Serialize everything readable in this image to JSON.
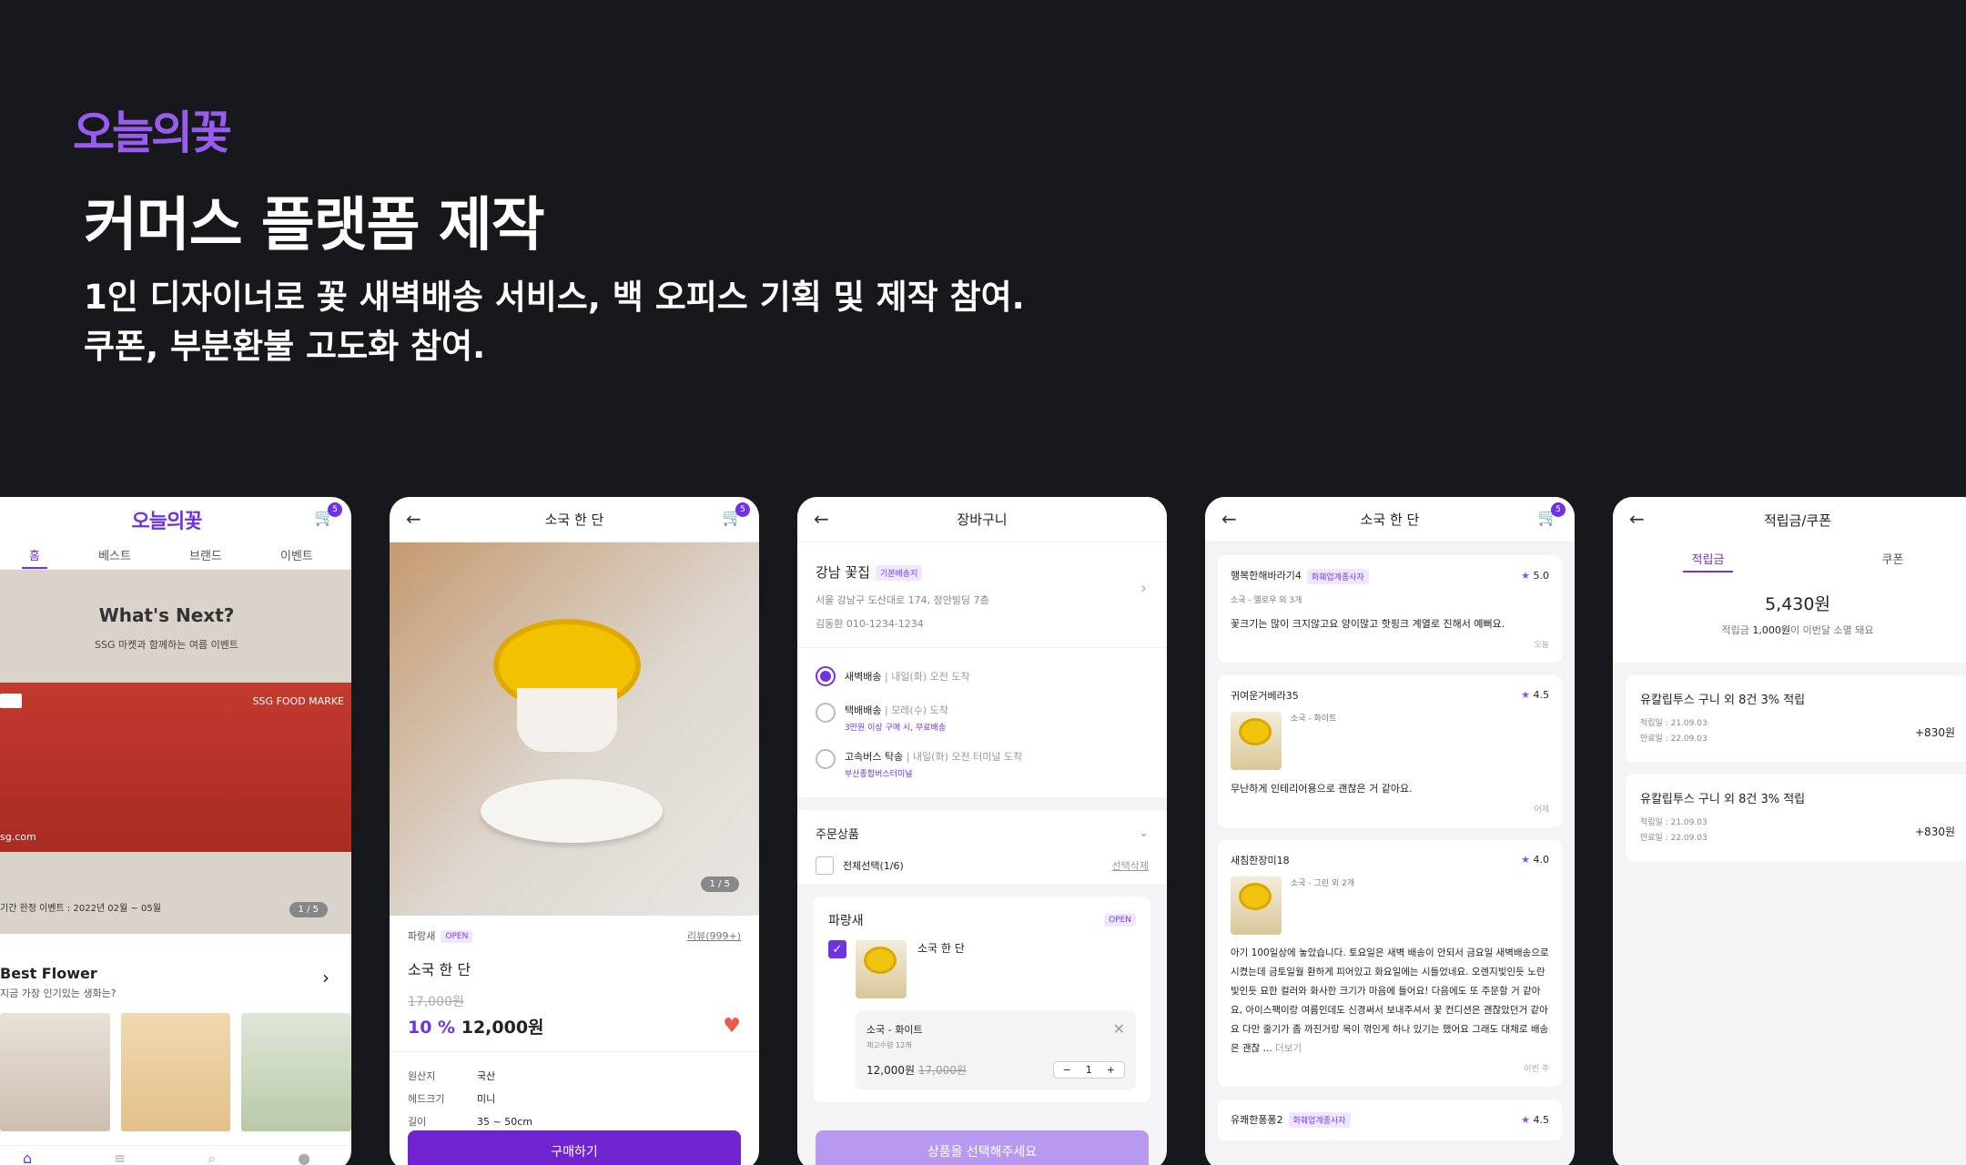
{
  "brand": {
    "logo": "오늘의꽃"
  },
  "hero": {
    "title": "커머스 플랫폼 제작",
    "line1": "1인 디자이너로 꽃 새벽배송 서비스, 백 오피스 기획 및 제작 참여.",
    "line2": "쿠폰, 부분환불 고도화 참여."
  },
  "home": {
    "logo": "오늘의꽃",
    "cart_count": "5",
    "tabs": [
      "홈",
      "베스트",
      "브랜드",
      "이벤트"
    ],
    "banner": {
      "title": "What's Next?",
      "subtitle": "SSG 마켓과 함께하는 여름 이벤트",
      "market": "SSG FOOD MARKE",
      "site": "sg.com",
      "period": "기간 한정 이벤트 : 2022년 02월 ~ 05월",
      "page": "1 / 5"
    },
    "section": {
      "title": "Best Flower",
      "subtitle": "지금 가장 인기있는 생화는?"
    }
  },
  "detail": {
    "title": "소국 한 단",
    "cart_count": "5",
    "image_page": "1 / 5",
    "shop": "파랑새",
    "open": "OPEN",
    "reviews": "리뷰(999+)",
    "name": "소국 한 단",
    "orig_price": "17,000원",
    "discount": "10 %",
    "price": "12,000원",
    "specs": [
      {
        "k": "원산지",
        "v": "국산"
      },
      {
        "k": "헤드크기",
        "v": "미니"
      },
      {
        "k": "길이",
        "v": "35 ~ 50cm"
      }
    ],
    "buy": "구매하기"
  },
  "cartpage": {
    "title": "장바구니",
    "store": "강남 꽃집",
    "store_tag": "기본배송지",
    "address": "서울 강남구 도산대로 174, 정안빌딩 7층",
    "contact": "김동환  010-1234-1234",
    "options": [
      {
        "name": "새벽배송",
        "desc": "내일(화) 오전 도착",
        "note": ""
      },
      {
        "name": "택배배송",
        "desc": "모레(수) 도착",
        "note": "3만원 이상 구매 시, 무료배송"
      },
      {
        "name": "고속버스 탁송",
        "desc": "내일(화) 오전 터미널 도착",
        "note": "부산종합버스터미널"
      }
    ],
    "order_label": "주문상품",
    "select_all": "전체선택(1/6)",
    "delete_sel": "선택삭제",
    "shop": "파랑새",
    "open": "OPEN",
    "item": "소국 한 단",
    "opt_name": "소국 - 화이트",
    "stock": "재고수량 12개",
    "price": "12,000원",
    "orig": "17,000원",
    "qty": "1",
    "cta": "상품을 선택해주세요"
  },
  "reviews": {
    "title": "소국 한 단",
    "cart_count": "5",
    "items": [
      {
        "user": "행복한해바라기4",
        "tag": "화훼업계종사자",
        "score": "5.0",
        "opt": "소국 - 옐로우 외 3개",
        "text": "꽃크기는 많이 크지않고요 양이많고 핫핑크 계열로 진해서 예뻐요.",
        "date": "오늘"
      },
      {
        "user": "귀여운거베라35",
        "tag": "",
        "score": "4.5",
        "opt": "소국 - 화이트",
        "text": "무난하게 인테리어용으로 괜찮은 거 같아요.",
        "date": "어제"
      },
      {
        "user": "새침한장미18",
        "tag": "",
        "score": "4.0",
        "opt": "소국 - 그린 외 2개",
        "text": "아기 100일상에 놓았습니다. 토요일은 새벽 배송이 안되서 금요일 새벽배송으로 시켰는데 금토일월 환하게 피어있고 화요일에는 시들었네요. 오렌지빛인듯 노란빛인듯 묘한 컬러와 화사한 크기가 마음에 들어요! 다음에도 또 주문할 거 같아요, 아이스팩이랑 여름인데도 신경써서 보내주셔서 꽃 컨디션은 괜찮았던거 같아요 다만 줄기가 좀 까진거랑 목이 꺾인게 하나 있기는 했어요 그래도 대체로 배송은 괜찮 ...",
        "more": "더보기",
        "date": "이번 주"
      },
      {
        "user": "유쾌한퐁퐁2",
        "tag": "화훼업계종사자",
        "score": "4.5"
      }
    ]
  },
  "points": {
    "title": "적립금/쿠폰",
    "tabs": [
      "적립금",
      "쿠폰"
    ],
    "amount": "5,430원",
    "expire_pre": "적립금 ",
    "expire_amt": "1,000원",
    "expire_post": "이 이번달 소멸 돼요",
    "items": [
      {
        "name": "유칼립투스 구니 외 8건 3% 적립",
        "d1": "적립일 : 21.09.03",
        "d2": "만료일 : 22.09.03",
        "amt": "+830원"
      },
      {
        "name": "유칼립투스 구니 외 8건 3% 적립",
        "d1": "적립일 : 21.09.03",
        "d2": "만료일 : 22.09.03",
        "amt": "+830원"
      }
    ]
  },
  "colors": {
    "accent": "#6f33e3",
    "background": "#17181c"
  }
}
